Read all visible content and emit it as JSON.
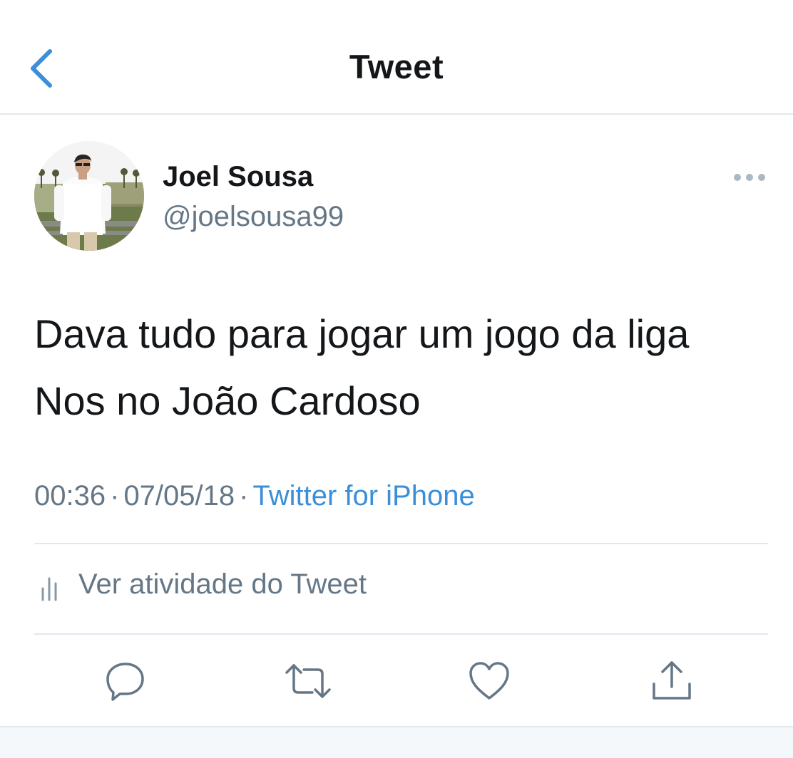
{
  "header": {
    "title": "Tweet",
    "back_icon": "chevron-left-icon"
  },
  "author": {
    "display_name": "Joel Sousa",
    "handle": "@joelsousa99",
    "avatar": "profile-photo"
  },
  "tweet": {
    "text_line1": "Dava tudo para jogar um jogo da liga",
    "text_line2": "Nos no João Cardoso",
    "time": "00:36",
    "date": "07/05/18",
    "separator": "·",
    "source": "Twitter for iPhone"
  },
  "activity": {
    "label": "Ver atividade do Tweet",
    "icon": "analytics-icon"
  },
  "actions": [
    "reply-icon",
    "retweet-icon",
    "like-icon",
    "share-icon"
  ],
  "colors": {
    "accent": "#3b8fd8",
    "text_primary": "#14171a",
    "text_secondary": "#657786",
    "divider": "#e1e8ed"
  }
}
